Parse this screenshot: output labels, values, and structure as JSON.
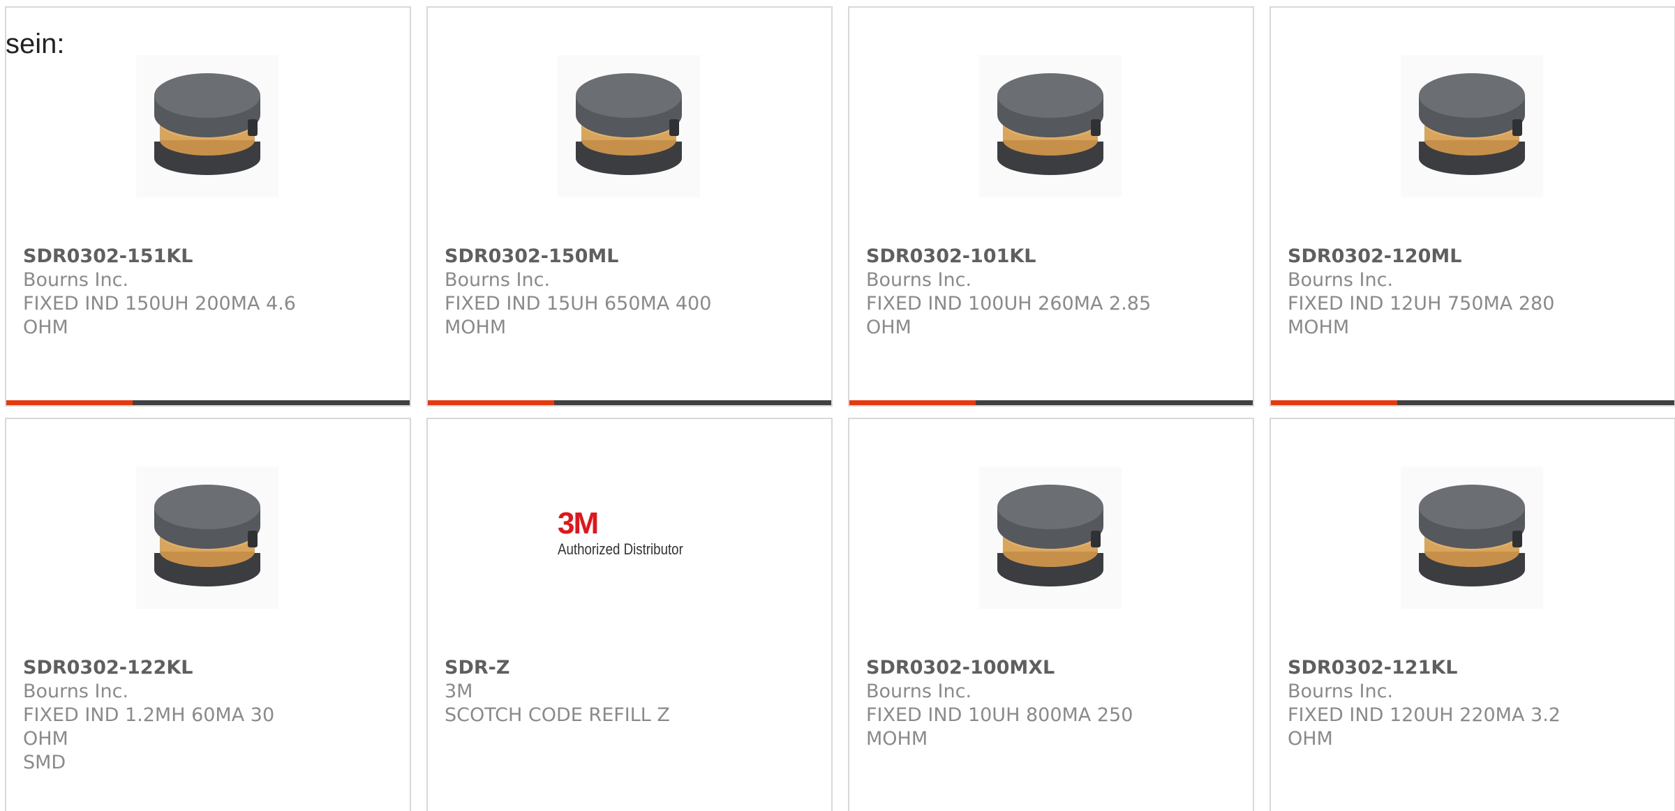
{
  "lead_text": "sein:",
  "colors": {
    "accent": "#e43a0e",
    "bar": "#414141",
    "border": "#d8d8d8",
    "part_number": "#5f5f5f",
    "secondary_text": "#8a8a8a",
    "brand_3m": "#e4141b"
  },
  "products": [
    {
      "part_number": "SDR0302-151KL",
      "manufacturer": "Bourns Inc.",
      "description_line1": "FIXED IND 150UH 200MA 4.6",
      "description_line2": "OHM",
      "image": "inductor-image"
    },
    {
      "part_number": "SDR0302-150ML",
      "manufacturer": "Bourns Inc.",
      "description_line1": "FIXED IND 15UH 650MA 400",
      "description_line2": "MOHM",
      "image": "inductor-image"
    },
    {
      "part_number": "SDR0302-101KL",
      "manufacturer": "Bourns Inc.",
      "description_line1": "FIXED IND 100UH 260MA 2.85",
      "description_line2": "OHM",
      "image": "inductor-image"
    },
    {
      "part_number": "SDR0302-120ML",
      "manufacturer": "Bourns Inc.",
      "description_line1": "FIXED IND 12UH 750MA 280",
      "description_line2": "MOHM",
      "image": "inductor-image"
    },
    {
      "part_number": "SDR0302-122KL",
      "manufacturer": "Bourns Inc.",
      "description_line1": "FIXED IND 1.2MH 60MA 30 OHM",
      "description_line2": "SMD",
      "image": "inductor-image"
    },
    {
      "part_number": "SDR-Z",
      "manufacturer": "3M",
      "description_line1": "SCOTCH CODE REFILL Z",
      "description_line2": "",
      "image": "3m-logo",
      "logo_mark": "3M",
      "logo_tagline": "Authorized Distributor"
    },
    {
      "part_number": "SDR0302-100MXL",
      "manufacturer": "Bourns Inc.",
      "description_line1": "FIXED IND 10UH 800MA 250",
      "description_line2": "MOHM",
      "image": "inductor-image"
    },
    {
      "part_number": "SDR0302-121KL",
      "manufacturer": "Bourns Inc.",
      "description_line1": "FIXED IND 120UH 220MA 3.2",
      "description_line2": "OHM",
      "image": "inductor-image"
    }
  ]
}
